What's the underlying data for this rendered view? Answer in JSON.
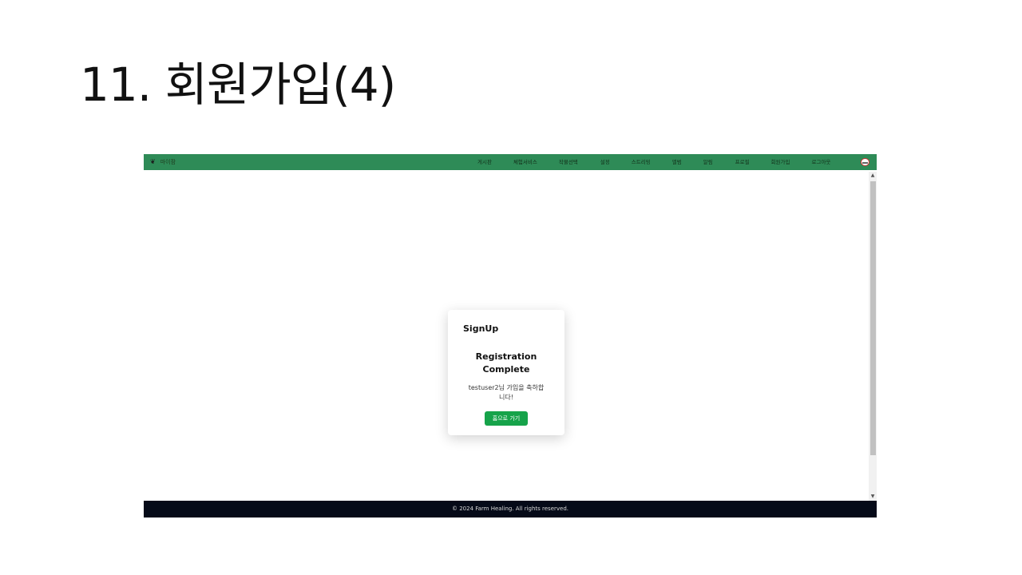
{
  "slide": {
    "title": "11. 회원가입(4)"
  },
  "navbar": {
    "brand_icon": "leaf-icon",
    "brand_label": "마이팜",
    "items": [
      "게시판",
      "체험서비스",
      "작물선택",
      "설정",
      "스트리밍",
      "앨범",
      "알림",
      "프로필",
      "회원가입",
      "로그아웃"
    ],
    "avatar_icon": "user-avatar-icon",
    "color": "#2e8b57"
  },
  "card": {
    "heading": "SignUp",
    "title_line1": "Registration",
    "title_line2": "Complete",
    "message_line1": "testuser2님 가입을 축하합",
    "message_line2": "니다!",
    "button_label": "홈으로 가기",
    "button_color": "#16a34a"
  },
  "footer": {
    "text": "© 2024 Farm Healing. All rights reserved.",
    "color": "#050a18"
  }
}
